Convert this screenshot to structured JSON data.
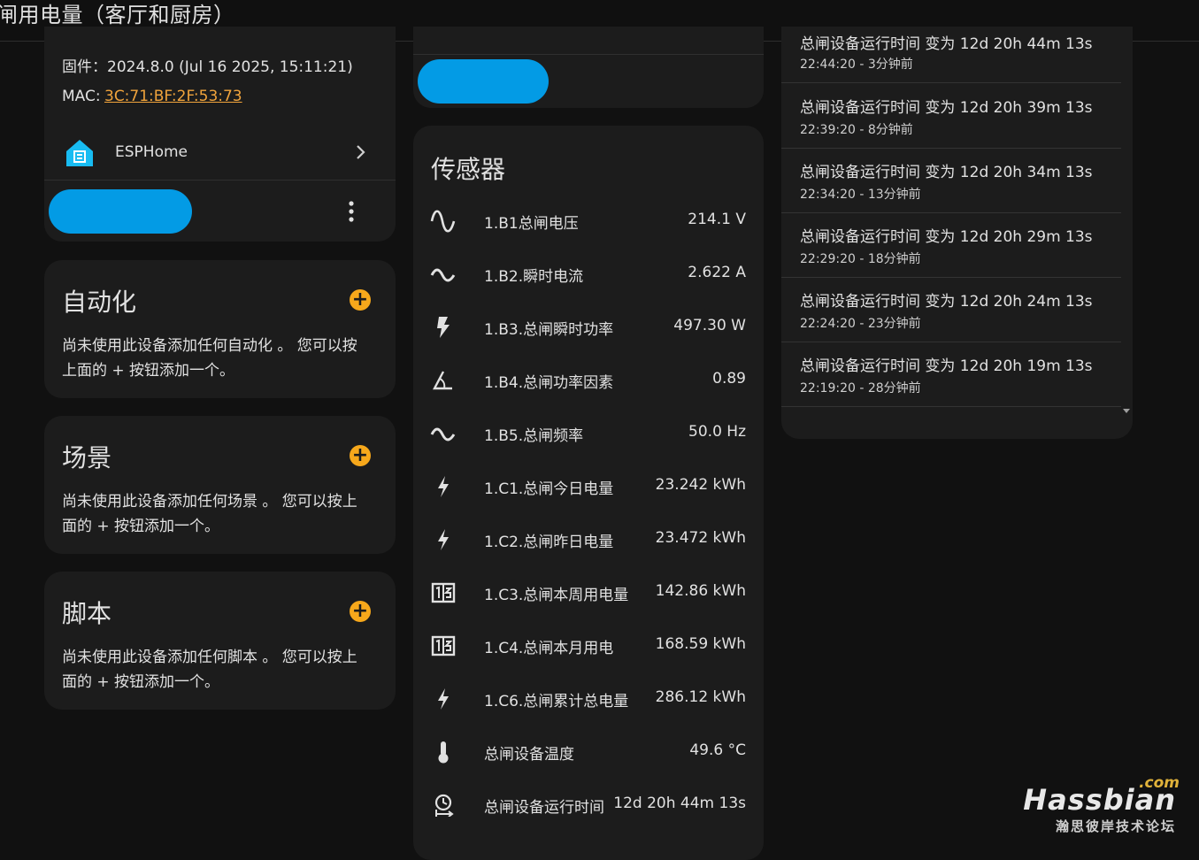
{
  "header": {
    "title": "闸用电量（客厅和厨房）"
  },
  "device_info": {
    "firmware": "固件：2024.8.0 (Jul 16 2025, 15:11:21)",
    "mac_label": "MAC: ",
    "mac_value": "3C:71:BF:2F:53:73",
    "integration": "ESPHome"
  },
  "automation": {
    "title": "自动化",
    "description_line1": "尚未使用此设备添加任何自动化 。 您可以按",
    "description_line2": "上面的 + 按钮添加一个。"
  },
  "scene": {
    "title": "场景",
    "description_line1": "尚未使用此设备添加任何场景 。 您可以按上",
    "description_line2": "面的 + 按钮添加一个。"
  },
  "script": {
    "title": "脚本",
    "description_line1": "尚未使用此设备添加任何脚本 。 您可以按上",
    "description_line2": "面的 + 按钮添加一个。"
  },
  "sensors": {
    "title": "传感器",
    "items": [
      {
        "icon": "sine-wave-icon",
        "name": "1.B1总闸电压",
        "value": "214.1 V"
      },
      {
        "icon": "current-ac-icon",
        "name": "1.B2.瞬时电流",
        "value": "2.622 A"
      },
      {
        "icon": "flash-icon",
        "name": "1.B3.总闸瞬时功率",
        "value": "497.30 W"
      },
      {
        "icon": "angle-icon",
        "name": "1.B4.总闸功率因素",
        "value": "0.89"
      },
      {
        "icon": "current-ac-icon",
        "name": "1.B5.总闸频率",
        "value": "50.0 Hz"
      },
      {
        "icon": "lightning-icon",
        "name": "1.C1.总闸今日电量",
        "value": "23.242 kWh"
      },
      {
        "icon": "lightning-icon",
        "name": "1.C2.总闸昨日电量",
        "value": "23.472 kWh"
      },
      {
        "icon": "meter-icon",
        "name": "1.C3.总闸本周用电量",
        "value": "142.86 kWh"
      },
      {
        "icon": "meter-icon",
        "name": "1.C4.总闸本月用电",
        "value": "168.59 kWh"
      },
      {
        "icon": "lightning-icon",
        "name": "1.C6.总闸累计总电量",
        "value": "286.12 kWh"
      },
      {
        "icon": "thermometer-icon",
        "name": "总闸设备温度",
        "value": "49.6 °C"
      },
      {
        "icon": "timer-icon",
        "name": "总闸设备运行时间",
        "value": "12d 20h 44m 13s"
      }
    ]
  },
  "logbook": {
    "partial_top": "总闸设备运行时间 变为 12d 20h 44m 13s",
    "items": [
      {
        "message": "",
        "time": "22:44:20 - 3分钟前"
      },
      {
        "message": "总闸设备运行时间 变为 12d 20h 39m 13s",
        "time": "22:39:20 - 8分钟前"
      },
      {
        "message": "总闸设备运行时间 变为 12d 20h 34m 13s",
        "time": "22:34:20 - 13分钟前"
      },
      {
        "message": "总闸设备运行时间 变为 12d 20h 29m 13s",
        "time": "22:29:20 - 18分钟前"
      },
      {
        "message": "总闸设备运行时间 变为 12d 20h 24m 13s",
        "time": "22:24:20 - 23分钟前"
      },
      {
        "message": "总闸设备运行时间 变为 12d 20h 19m 13s",
        "time": "22:19:20 - 28分钟前"
      }
    ]
  },
  "watermark": {
    "brand": "Hassbian",
    "tld": ".com",
    "subtitle": "瀚思彼岸技术论坛"
  },
  "colors": {
    "accent": "#039be5",
    "warning": "#f7a81b",
    "link": "#f1a43c",
    "card": "#1c1c1c",
    "background": "#111111"
  }
}
